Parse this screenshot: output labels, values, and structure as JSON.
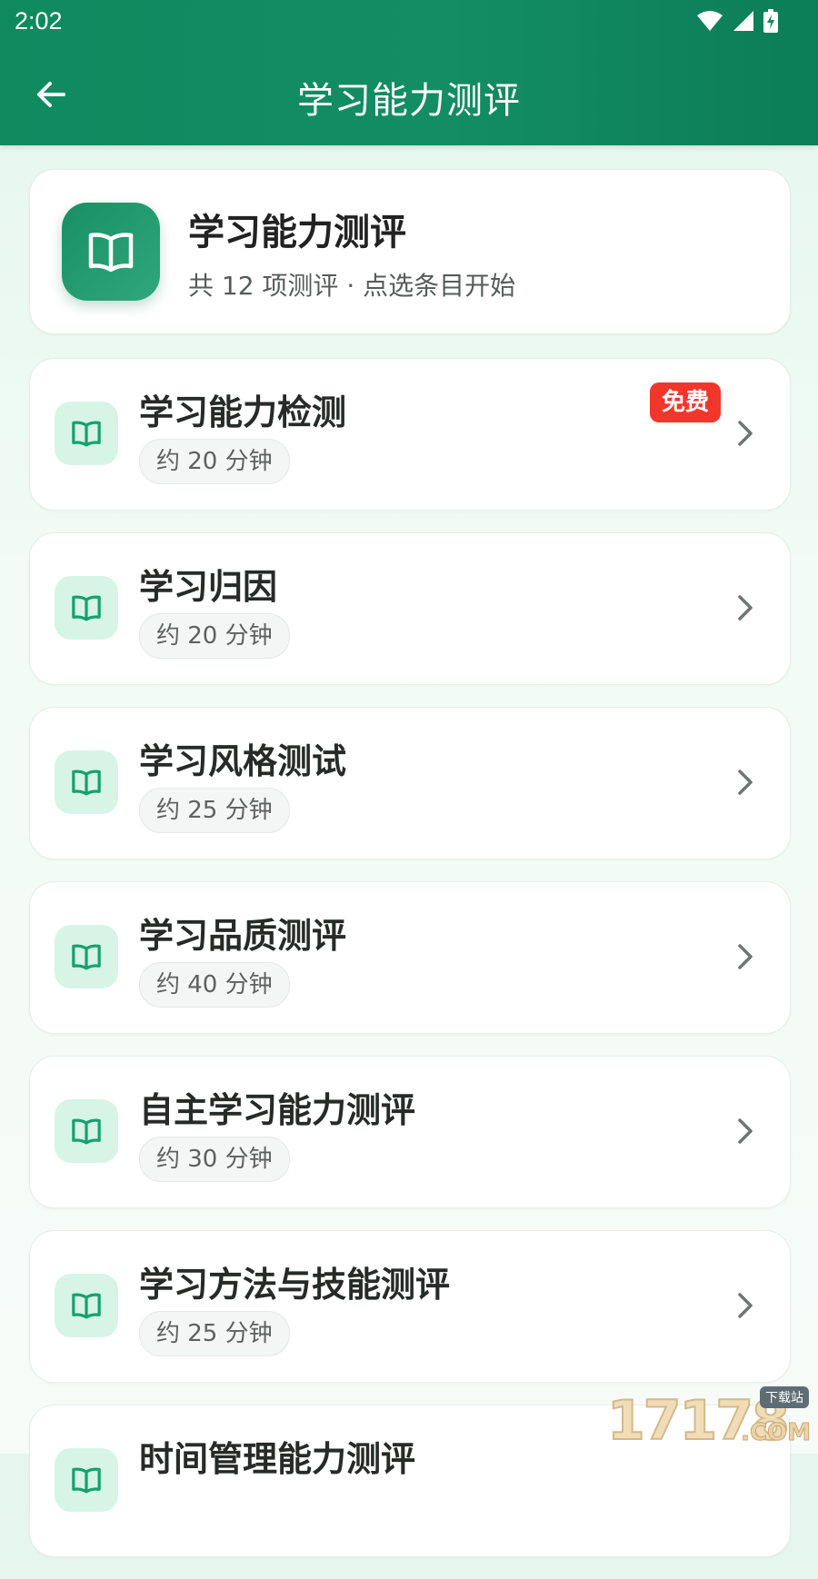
{
  "status_bar": {
    "time": "2:02",
    "icons": [
      "wifi-icon",
      "cellular-signal-icon",
      "battery-charging-icon"
    ]
  },
  "app_bar": {
    "back_icon": "arrow-left-icon",
    "title": "学习能力测评"
  },
  "hero": {
    "icon": "open-book-icon",
    "title": "学习能力测评",
    "subtitle": "共 12 项测评 · 点选条目开始"
  },
  "assessments": [
    {
      "title": "学习能力检测",
      "duration": "约 20 分钟",
      "badge": "免费"
    },
    {
      "title": "学习归因",
      "duration": "约 20 分钟"
    },
    {
      "title": "学习风格测试",
      "duration": "约 25 分钟"
    },
    {
      "title": "学习品质测评",
      "duration": "约 40 分钟"
    },
    {
      "title": "自主学习能力测评",
      "duration": "约 30 分钟"
    },
    {
      "title": "学习方法与技能测评",
      "duration": "约 25 分钟"
    },
    {
      "title": "时间管理能力测评",
      "duration": ""
    }
  ],
  "watermark": {
    "digits": "17178",
    "suffix": ".COM",
    "tag": "下载站"
  },
  "colors": {
    "primary": "#0f8a5f",
    "icon_tile_bg": "#d6f5e6",
    "badge_red": "#f2362b",
    "page_bg": "#eaf7f0"
  }
}
